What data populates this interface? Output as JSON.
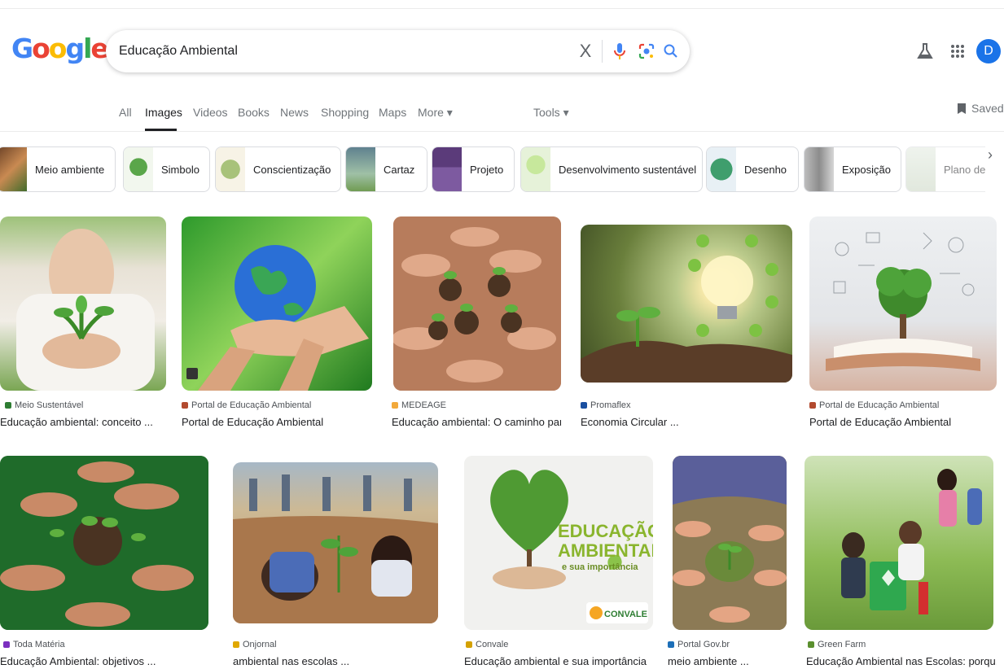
{
  "header": {
    "logo_letters": [
      "G",
      "o",
      "o",
      "g",
      "l",
      "e"
    ],
    "logo_colors": [
      "#4285f4",
      "#ea4335",
      "#fbbc05",
      "#4285f4",
      "#34a853",
      "#ea4335"
    ],
    "search_value": "Educação Ambiental",
    "clear_icon": "X",
    "avatar_letter": "D"
  },
  "tabs": {
    "all": "All",
    "images": "Images",
    "videos": "Videos",
    "books": "Books",
    "news": "News",
    "shopping": "Shopping",
    "maps": "Maps",
    "more": "More ▾",
    "tools": "Tools ▾",
    "saved": "Saved"
  },
  "chips": [
    {
      "label": "Meio ambiente",
      "color": "#8a5a3b"
    },
    {
      "label": "Simbolo",
      "color": "#5aa64a"
    },
    {
      "label": "Conscientização",
      "color": "#b6c98f"
    },
    {
      "label": "Cartaz",
      "color": "#6b8f9e"
    },
    {
      "label": "Projeto",
      "color": "#5b3b7a"
    },
    {
      "label": "Desenvolvimento sustentável",
      "color": "#9ccf6a"
    },
    {
      "label": "Desenho",
      "color": "#3f9e6d"
    },
    {
      "label": "Exposição",
      "color": "#8c8c8c"
    },
    {
      "label": "Plano de",
      "color": "#c9d6c2"
    }
  ],
  "chip_next_icon": "›",
  "results": [
    {
      "source": "Meio Sustentável",
      "title": "Educação ambiental: conceito ...",
      "fav": "#2e7d32"
    },
    {
      "source": "Portal de Educação Ambiental",
      "title": "Portal de Educação Ambiental",
      "fav": "#b24a2f"
    },
    {
      "source": "MEDEAGE",
      "title": "Educação ambiental: O caminho par...",
      "fav": "#f2a93b"
    },
    {
      "source": "Promaflex",
      "title": "Economia Circular ...",
      "fav": "#1a4fa0"
    },
    {
      "source": "Portal de Educação Ambiental",
      "title": "Portal de Educação Ambiental",
      "fav": "#b24a2f"
    },
    {
      "source": "Toda Matéria",
      "title": "Educação Ambiental: objetivos ...",
      "fav": "#7b2fbf"
    },
    {
      "source": "Onjornal",
      "title": "ambiental nas escolas ...",
      "fav": "#e0a800"
    },
    {
      "source": "Convale",
      "title": "Educação ambiental e sua importância",
      "fav": "#d4a100"
    },
    {
      "source": "Portal Gov.br",
      "title": "meio ambiente ...",
      "fav": "#1d6fb8"
    },
    {
      "source": "Green Farm",
      "title": "Educação Ambiental nas Escolas: porqu...",
      "fav": "#5a8f2e"
    }
  ],
  "convale_image": {
    "line1": "EDUCAÇÃO",
    "line2": "AMBIENTAL",
    "line3": "e sua importância",
    "brand": "CONVALE"
  }
}
